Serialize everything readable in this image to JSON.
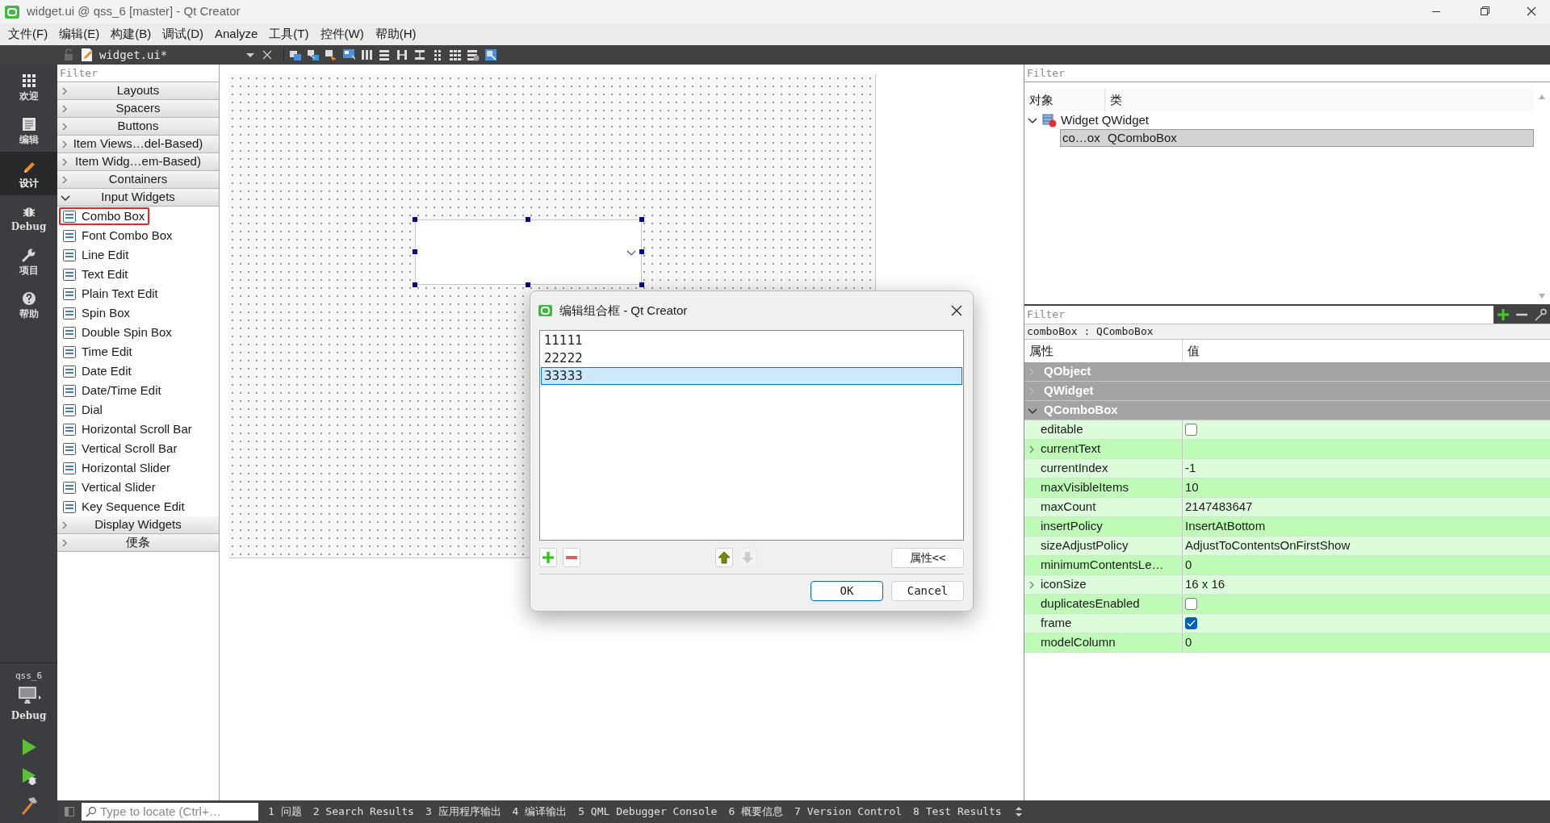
{
  "window": {
    "title": "widget.ui @ qss_6 [master] - Qt Creator"
  },
  "menu_bar": [
    "文件(F)",
    "编辑(E)",
    "构建(B)",
    "调试(D)",
    "Analyze",
    "工具(T)",
    "控件(W)",
    "帮助(H)"
  ],
  "editor_toolbar": {
    "document": "widget.ui*"
  },
  "mode_bar": {
    "modes": [
      {
        "kind": "welcome",
        "label": "欢迎",
        "selected": false
      },
      {
        "kind": "edit",
        "label": "编辑",
        "selected": false
      },
      {
        "kind": "design",
        "label": "设计",
        "selected": true
      },
      {
        "kind": "debug",
        "label": "Debug",
        "selected": false
      },
      {
        "kind": "projects",
        "label": "项目",
        "selected": false
      },
      {
        "kind": "help",
        "label": "帮助",
        "selected": false
      }
    ],
    "kit": {
      "project": "qss_6",
      "build": "Debug"
    }
  },
  "widget_box": {
    "filter": {
      "placeholder": "Filter"
    },
    "categories": [
      {
        "label": "Layouts",
        "expanded": false
      },
      {
        "label": "Spacers",
        "expanded": false
      },
      {
        "label": "Buttons",
        "expanded": false
      },
      {
        "label": "Item Views…del-Based)",
        "expanded": false
      },
      {
        "label": "Item Widg…em-Based)",
        "expanded": false
      },
      {
        "label": "Containers",
        "expanded": false
      },
      {
        "label": "Input Widgets",
        "expanded": true,
        "children": [
          {
            "label": "Combo Box",
            "highlighted": true
          },
          {
            "label": "Font Combo Box",
            "highlighted": false
          },
          {
            "label": "Line Edit",
            "highlighted": false
          },
          {
            "label": "Text Edit",
            "highlighted": false
          },
          {
            "label": "Plain Text Edit",
            "highlighted": false
          },
          {
            "label": "Spin Box",
            "highlighted": false
          },
          {
            "label": "Double Spin Box",
            "highlighted": false
          },
          {
            "label": "Time Edit",
            "highlighted": false
          },
          {
            "label": "Date Edit",
            "highlighted": false
          },
          {
            "label": "Date/Time Edit",
            "highlighted": false
          },
          {
            "label": "Dial",
            "highlighted": false
          },
          {
            "label": "Horizontal Scroll Bar",
            "highlighted": false
          },
          {
            "label": "Vertical Scroll Bar",
            "highlighted": false
          },
          {
            "label": "Horizontal Slider",
            "highlighted": false
          },
          {
            "label": "Vertical Slider",
            "highlighted": false
          },
          {
            "label": "Key Sequence Edit",
            "highlighted": false
          }
        ]
      },
      {
        "label": "Display Widgets",
        "expanded": false
      },
      {
        "label": "便条",
        "expanded": false
      }
    ]
  },
  "dialog": {
    "title": "编辑组合框 - Qt Creator",
    "items": [
      {
        "text": "11111",
        "selected": false
      },
      {
        "text": "22222",
        "selected": false
      },
      {
        "text": "33333",
        "selected": true
      }
    ],
    "tool_buttons": [
      {
        "kind": "add",
        "disabled": false
      },
      {
        "kind": "remove",
        "disabled": false
      },
      {
        "kind": "up",
        "disabled": false
      },
      {
        "kind": "down",
        "disabled": true
      }
    ],
    "buttons": {
      "properties": "属性<<",
      "ok": "OK",
      "cancel": "Cancel"
    }
  },
  "object_inspector": {
    "filter": {
      "placeholder": "Filter"
    },
    "columns": [
      "对象",
      "类"
    ],
    "tree": [
      {
        "object": "Widget",
        "class": "QWidget",
        "expanded": true,
        "selected": false,
        "children": [
          {
            "object": "co…ox",
            "class": "QComboBox",
            "selected": true
          }
        ]
      }
    ]
  },
  "property_editor": {
    "filter": {
      "placeholder": "Filter"
    },
    "object_label": "comboBox : QComboBox",
    "columns": [
      "属性",
      "值"
    ],
    "groups": [
      {
        "name": "QObject",
        "expanded": false
      },
      {
        "name": "QWidget",
        "expanded": false
      },
      {
        "name": "QComboBox",
        "expanded": true,
        "properties": [
          {
            "name": "editable",
            "kind": "checkbox",
            "checked": false,
            "expandable": false
          },
          {
            "name": "currentText",
            "kind": "text",
            "expandable": true
          },
          {
            "name": "currentIndex",
            "kind": "text",
            "value": "-1",
            "expandable": false
          },
          {
            "name": "maxVisibleItems",
            "kind": "text",
            "value": "10",
            "expandable": false
          },
          {
            "name": "maxCount",
            "kind": "text",
            "value": "2147483647",
            "expandable": false
          },
          {
            "name": "insertPolicy",
            "kind": "text",
            "value": "InsertAtBottom",
            "expandable": false
          },
          {
            "name": "sizeAdjustPolicy",
            "kind": "text",
            "value": "AdjustToContentsOnFirstShow",
            "expandable": false
          },
          {
            "name": "minimumContentsLe…",
            "kind": "text",
            "value": "0",
            "expandable": false
          },
          {
            "name": "iconSize",
            "kind": "text",
            "value": "16 x 16",
            "expandable": true
          },
          {
            "name": "duplicatesEnabled",
            "kind": "checkbox",
            "checked": false,
            "expandable": false
          },
          {
            "name": "frame",
            "kind": "checkbox",
            "checked": true,
            "expandable": false
          },
          {
            "name": "modelColumn",
            "kind": "text",
            "value": "0",
            "expandable": false
          }
        ]
      }
    ]
  },
  "status_bar": {
    "locator": {
      "placeholder": "Type to locate (Ctrl+…"
    },
    "panes": [
      "1 问题",
      "2 Search Results",
      "3 应用程序输出",
      "4 编译输出",
      "5 QML Debugger Console",
      "6 概要信息",
      "7 Version Control",
      "8 Test Results"
    ]
  }
}
